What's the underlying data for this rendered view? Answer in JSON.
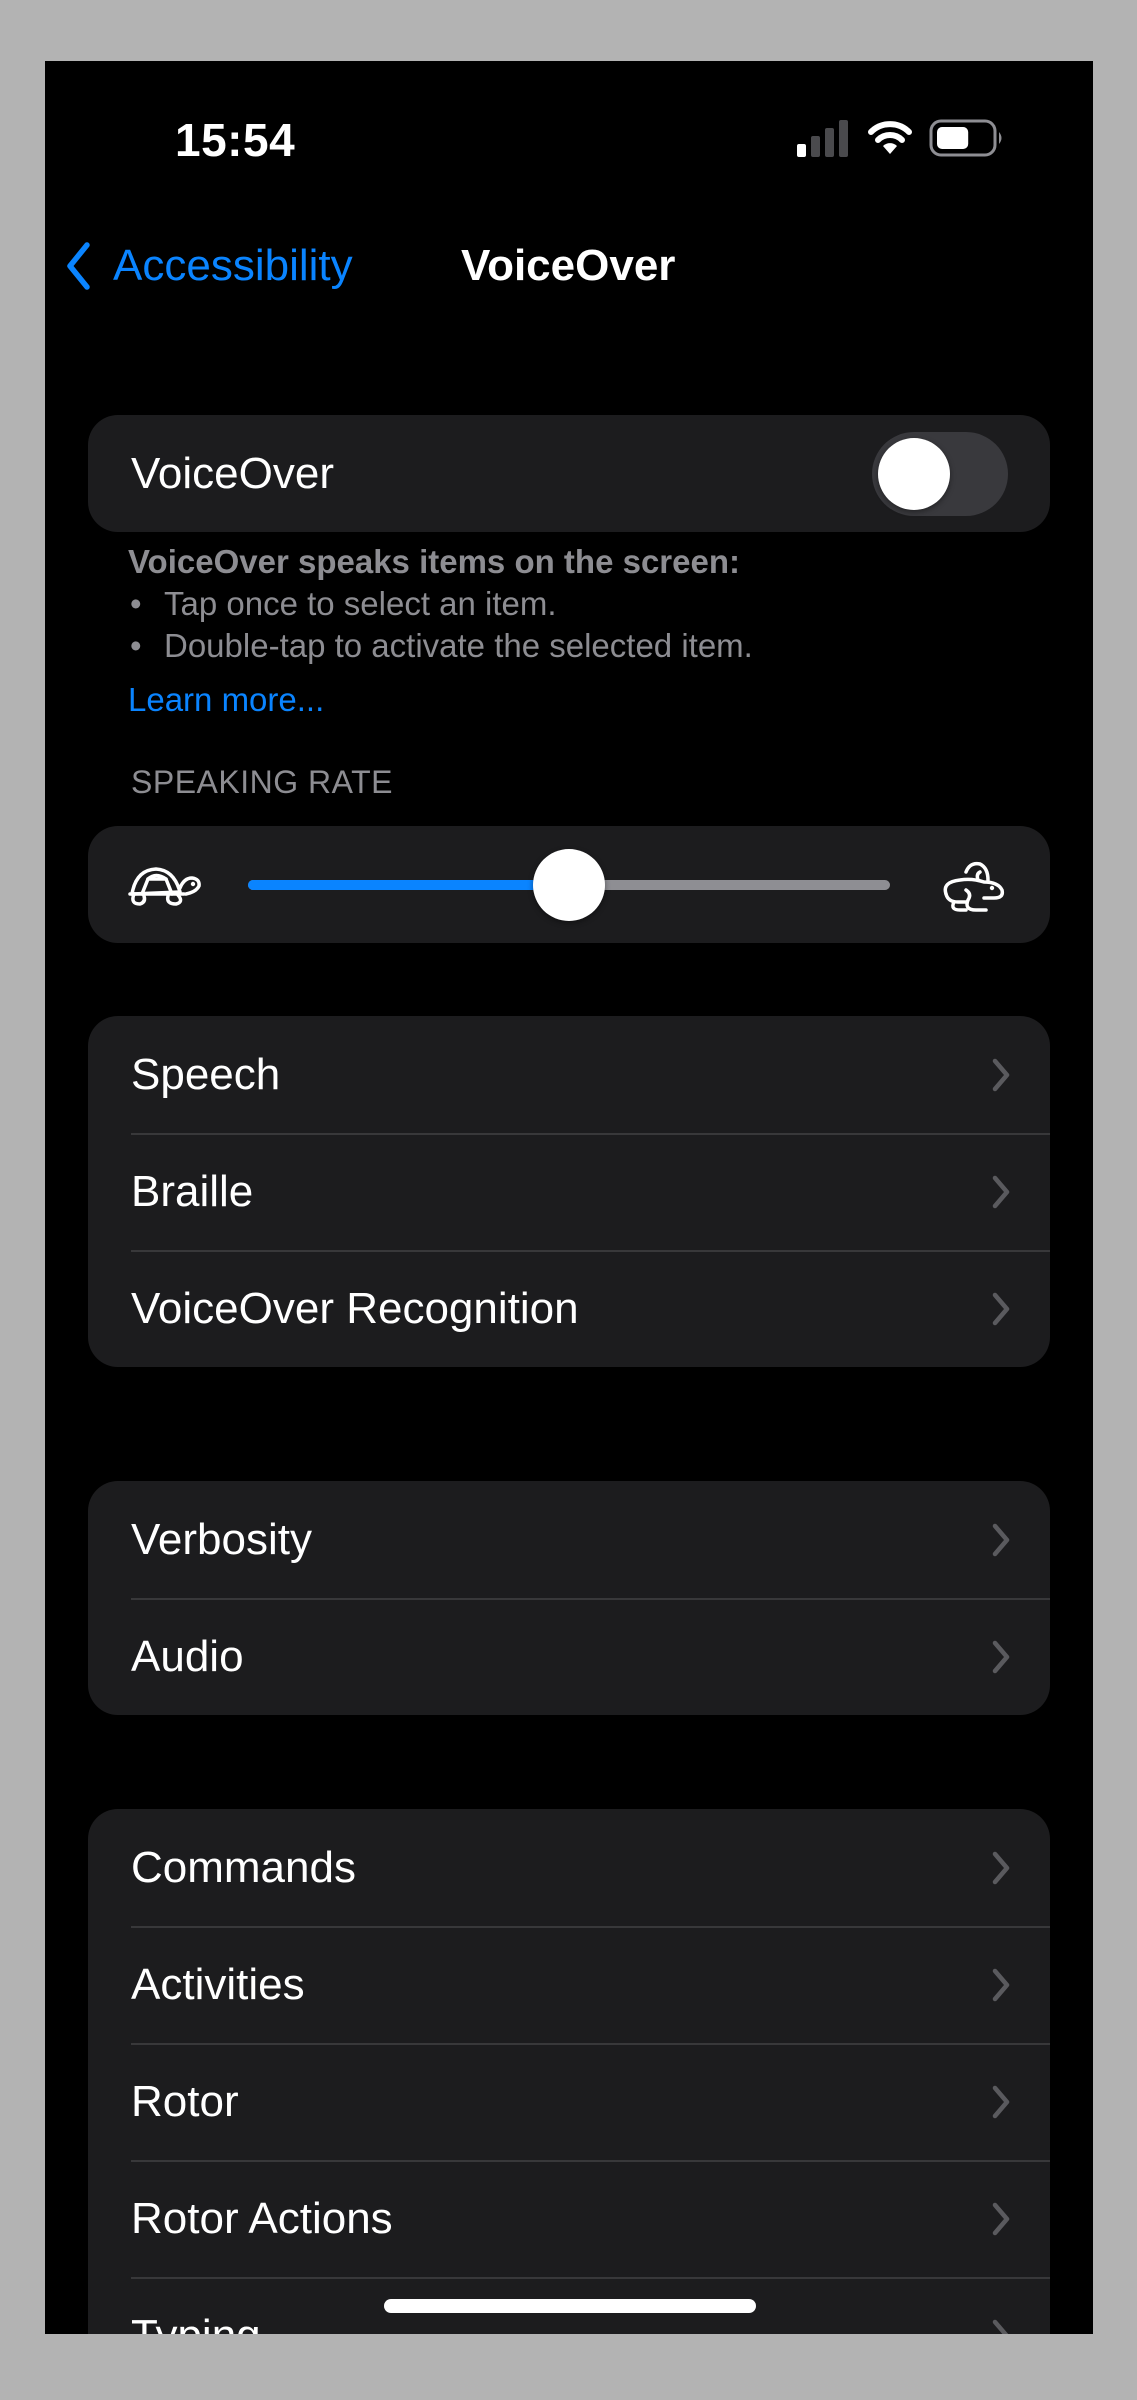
{
  "status_bar": {
    "time": "15:54",
    "signal_bars_active": 1,
    "signal_bars_total": 4,
    "wifi": "wifi-icon",
    "battery_level": 0.6
  },
  "nav": {
    "back_label": "Accessibility",
    "title": "VoiceOver"
  },
  "voiceover_toggle": {
    "label": "VoiceOver",
    "on": false
  },
  "description": {
    "heading": "VoiceOver speaks items on the screen:",
    "bullets": [
      "Tap once to select an item.",
      "Double-tap to activate the selected item."
    ],
    "bullet_char": "•",
    "learn_more": "Learn more..."
  },
  "speaking_rate": {
    "header": "SPEAKING RATE",
    "value": 0.5,
    "min_icon": "turtle-icon",
    "max_icon": "rabbit-icon"
  },
  "groups": [
    {
      "items": [
        {
          "label": "Speech"
        },
        {
          "label": "Braille"
        },
        {
          "label": "VoiceOver Recognition"
        }
      ]
    },
    {
      "items": [
        {
          "label": "Verbosity"
        },
        {
          "label": "Audio"
        }
      ]
    },
    {
      "items": [
        {
          "label": "Commands"
        },
        {
          "label": "Activities"
        },
        {
          "label": "Rotor"
        },
        {
          "label": "Rotor Actions"
        },
        {
          "label": "Typing"
        }
      ]
    }
  ],
  "colors": {
    "accent": "#0a84ff",
    "background": "#000000",
    "card": "#1c1c1e",
    "secondary_text": "#8d8d92",
    "toggle_off_track": "#39393d"
  }
}
